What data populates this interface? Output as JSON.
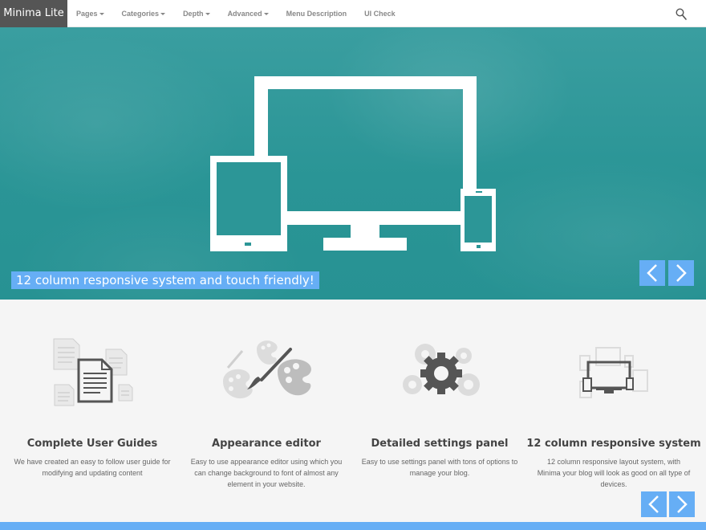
{
  "navbar": {
    "brand": "Minima Lite",
    "items": [
      {
        "label": "Pages",
        "has_caret": true
      },
      {
        "label": "Categories",
        "has_caret": true
      },
      {
        "label": "Depth",
        "has_caret": true
      },
      {
        "label": "Advanced",
        "has_caret": true
      },
      {
        "label": "Menu Description",
        "has_caret": false
      },
      {
        "label": "UI Check",
        "has_caret": false
      }
    ],
    "search_icon": "search-icon"
  },
  "hero": {
    "caption": "12 column responsive system and touch friendly!",
    "prev_icon": "chevron-left-icon",
    "next_icon": "chevron-right-icon"
  },
  "features": [
    {
      "icon": "documents-icon",
      "title": "Complete User Guides",
      "text": "We have created an easy to follow user guide for modifying and updating content"
    },
    {
      "icon": "palette-brush-icon",
      "title": "Appearance editor",
      "text": "Easy to use appearance editor using which you can change background to font of almost any element in your website."
    },
    {
      "icon": "gears-icon",
      "title": "Detailed settings panel",
      "text": "Easy to use settings panel with tons of options to manage your blog."
    },
    {
      "icon": "responsive-devices-icon",
      "title": "12 column responsive system",
      "text": "12 column responsive layout system, with Minima your blog will look as good on all type of devices."
    }
  ],
  "colors": {
    "accent": "#66aef5",
    "hero": "#2a9596",
    "brand_bg": "#555555"
  }
}
